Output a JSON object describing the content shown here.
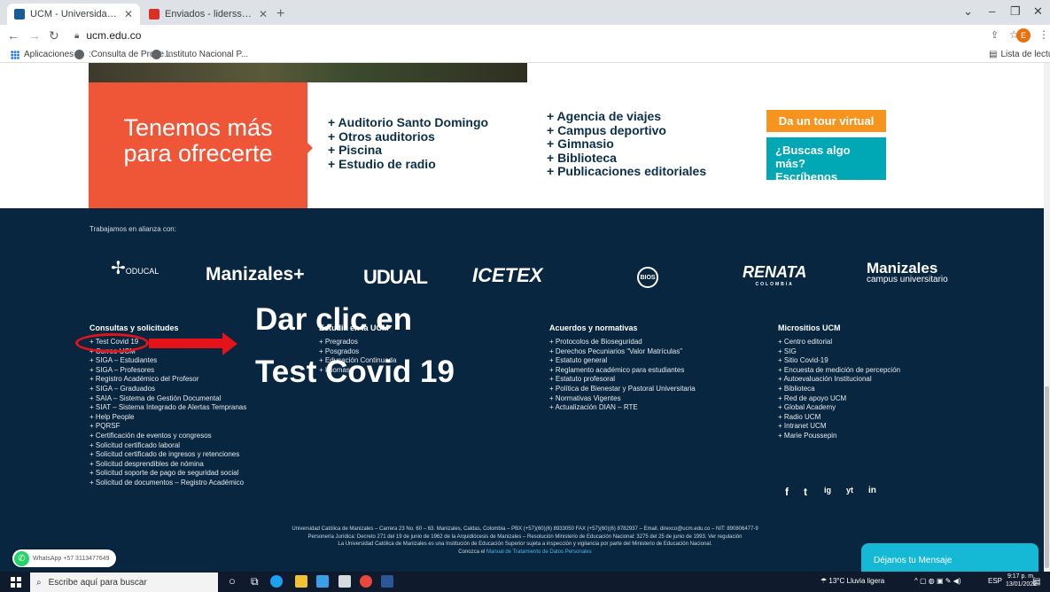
{
  "browser": {
    "tabs": [
      {
        "title": "UCM - Universidad Católica de M",
        "active": true,
        "favicon_color": "#1a5c96"
      },
      {
        "title": "Enviados - liderssst@ucm.edu.co",
        "active": false,
        "favicon_color": "#d93025"
      }
    ],
    "new_tab": "+",
    "url": "ucm.edu.co",
    "profile_initial": "E",
    "bookmarks": [
      "Aplicaciones",
      ":Consulta de Proce...",
      "Instituto Nacional P..."
    ],
    "reading_list": "Lista de lectura"
  },
  "offer": {
    "title_line1": "Tenemos más",
    "title_line2": "para ofrecerte",
    "color": "#ef5638",
    "col1": [
      "+ Auditorio Santo Domingo",
      "+ Otros auditorios",
      "+ Piscina",
      "+ Estudio de radio"
    ],
    "col2": [
      "+ Agencia de viajes",
      "+ Campus deportivo",
      "+ Gimnasio",
      "+ Biblioteca",
      "+ Publicaciones editoriales"
    ],
    "tour_button": "Da un tour virtual",
    "contact_line1": "¿Buscas algo más?",
    "contact_line2": "Escríbenos"
  },
  "footer": {
    "alliance_label": "Trabajamos en alianza con:",
    "logos": [
      "ODUCAL",
      "Manizales+",
      "UDUAL",
      "ICETEX",
      "BIOS",
      "RENATA",
      "COLOMBIA",
      "Manizales",
      "campus universitario"
    ],
    "columns": [
      {
        "title": "Consultas y solicitudes",
        "items": [
          "Test Covid 19",
          "Correo UCM",
          "SIGA – Estudiantes",
          "SIGA – Profesores",
          "Registro Académico del Profesor",
          "SIGA – Graduados",
          "SAIA – Sistema de Gestión Documental",
          "SIAT – Sistema Integrado de Alertas Tempranas",
          "Help People",
          "PQRSF",
          "Certificación de eventos y congresos",
          "Solicitud certificado laboral",
          "Solicitud certificado de ingresos y retenciones",
          "Solicitud desprendibles de nómina",
          "Solicitud soporte de pago de seguridad social",
          "Solicitud de documentos – Registro Académico"
        ]
      },
      {
        "title": "Estudia en la UCM",
        "items": [
          "Pregrados",
          "Posgrados",
          "Educación Continuada",
          "Idiomas"
        ]
      },
      {
        "title": "Acuerdos y normativas",
        "items": [
          "Protocolos de Bioseguridad",
          "Derechos Pecuniarios “Valor Matrículas”",
          "Estatuto general",
          "Reglamento académico para estudiantes",
          "Estatuto profesoral",
          "Política de Bienestar y Pastoral Universitaria",
          "Normativas Vigentes",
          "Actualización DIAN – RTE"
        ]
      },
      {
        "title": "Micrositios UCM",
        "items": [
          "Centro editorial",
          "SIG",
          "Sitio Covid-19",
          "Encuesta de medición de percepción",
          "Autoevaluación Institucional",
          "Biblioteca",
          "Red de apoyo UCM",
          "Global Academy",
          "Radio UCM",
          "Intranet UCM",
          "Marie Poussepin"
        ]
      }
    ],
    "social": [
      "f",
      "t",
      "ig",
      "yt",
      "in"
    ],
    "legal_line1": "Universidad Católica de Manizales – Carrera 23 No. 60 – 63. Manizales, Caldas, Colombia – PBX (+57)(60)(6) 8933050 FAX (+57)(60)(6) 8782937 – Email. direxco@ucm.edu.co – NIT: 890806477-9",
    "legal_line2": "Personería Jurídica: Decreto 271 del 19 de junio de 1962 de la Arquidiócesis de Manizales – Resolución Ministerio de Educación Nacional: 3275 del 25 de junio de 1993. Ver regulación",
    "legal_line3": "La Universidad Católica de Manizales es una Institución de Educación Superior sujeta a inspección y vigilancia por parte del Ministerio de Educación Nacional.",
    "legal_line4_prefix": "Conozca el",
    "legal_line4_link": "Manual de Tratamiento de Datos Personales"
  },
  "annotation": {
    "line1": "Dar clic en",
    "line2": "Test Covid 19",
    "color": "#e4131a"
  },
  "whatsapp": "WhatsApp +57 3113477649",
  "chat_button": "Déjanos tu Mensaje",
  "taskbar": {
    "search_placeholder": "Escribe aquí para buscar",
    "weather": "13°C  Lluvia ligera",
    "language": "ESP",
    "time": "9:17 p. m.",
    "date": "13/01/2022"
  }
}
